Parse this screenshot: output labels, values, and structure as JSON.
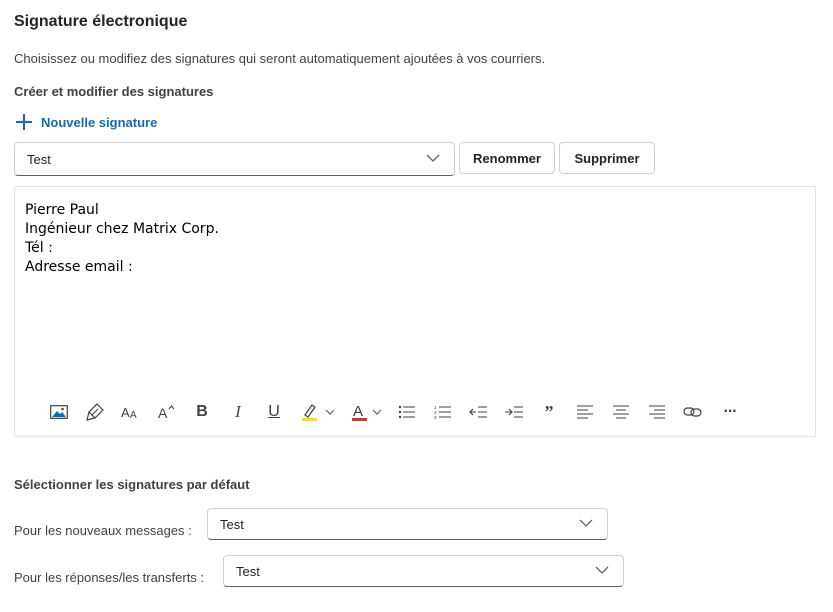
{
  "page": {
    "title": "Signature électronique",
    "description": "Choisissez ou modifiez des signatures qui seront automatiquement ajoutées à vos courriers.",
    "section_title": "Créer et modifier des signatures",
    "new_signature_label": "Nouvelle signature"
  },
  "signature_select": {
    "value": "Test"
  },
  "buttons": {
    "rename": "Renommer",
    "delete": "Supprimer"
  },
  "editor": {
    "lines": [
      "Pierre Paul",
      "Ingénieur chez Matrix Corp.",
      "Tél :",
      "Adresse email :"
    ]
  },
  "toolbar": {
    "items": [
      {
        "name": "insert-image-icon"
      },
      {
        "name": "format-painter-icon"
      },
      {
        "name": "font-size-icon"
      },
      {
        "name": "grow-font-icon"
      },
      {
        "name": "bold-icon",
        "glyph": "B"
      },
      {
        "name": "italic-icon",
        "glyph": "I"
      },
      {
        "name": "underline-icon",
        "glyph": "U"
      },
      {
        "name": "highlight-icon",
        "color": "#f5e500"
      },
      {
        "name": "font-color-icon",
        "color": "#d13438"
      },
      {
        "name": "bullets-icon"
      },
      {
        "name": "numbering-icon"
      },
      {
        "name": "decrease-indent-icon"
      },
      {
        "name": "increase-indent-icon"
      },
      {
        "name": "quote-icon",
        "glyph": "”"
      },
      {
        "name": "align-left-icon"
      },
      {
        "name": "align-center-icon"
      },
      {
        "name": "align-right-icon"
      },
      {
        "name": "link-icon"
      },
      {
        "name": "more-options-icon",
        "glyph": "···"
      }
    ]
  },
  "defaults": {
    "title": "Sélectionner les signatures par défaut",
    "new_messages_label": "Pour les nouveaux messages :",
    "new_messages_value": "Test",
    "replies_label": "Pour les réponses/les transferts :",
    "replies_value": "Test"
  },
  "colors": {
    "accent": "#0f6cbd"
  }
}
